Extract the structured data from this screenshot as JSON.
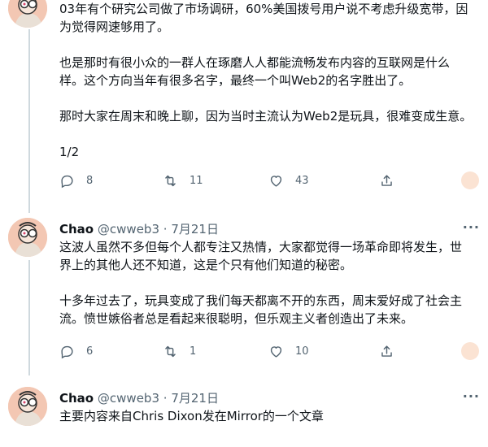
{
  "tweets": [
    {
      "text_lines": [
        "03年有个研究公司做了市场调研，60%美国拨号用户说不考虑升级宽带，因",
        "为觉得网速够用了。"
      ],
      "paragraphs": [
        [
          "也是那时有很小众的一群人在琢磨人人都能流畅发布内容的互联网是什么",
          "样。这个方向当年有很多名字，最终一个叫Web2的名字胜出了。"
        ],
        [
          "那时大家在周末和晚上聊，因为当时主流认为Web2是玩具，很难变成生意。"
        ],
        [
          "1/2"
        ]
      ],
      "replies": "8",
      "retweets": "11",
      "likes": "43"
    },
    {
      "name": "Chao",
      "handle": "@cwweb3",
      "dot": "·",
      "date": "7月21日",
      "paragraphs": [
        [
          "这波人虽然不多但每个人都专注又热情，大家都觉得一场革命即将发生，世",
          "界上的其他人还不知道，这是个只有他们知道的秘密。"
        ],
        [
          "十多年过去了，玩具变成了我们每天都离不开的东西，周末爱好成了社会主",
          "流。愤世嫉俗者总是看起来很聪明，但乐观主义者创造出了未来。"
        ]
      ],
      "replies": "6",
      "retweets": "1",
      "likes": "10"
    },
    {
      "name": "Chao",
      "handle": "@cwweb3",
      "dot": "·",
      "date": "7月21日",
      "paragraphs": [
        [
          "主要内容来自Chris Dixon发在Mirror的一个文章"
        ]
      ]
    }
  ],
  "more_label": "···",
  "icons": {
    "reply": "reply-icon",
    "retweet": "retweet-icon",
    "like": "heart-icon",
    "share": "share-icon"
  },
  "colors": {
    "text": "#0f1419",
    "secondary": "#536471",
    "avatar_bg": "#f3c7b3"
  }
}
